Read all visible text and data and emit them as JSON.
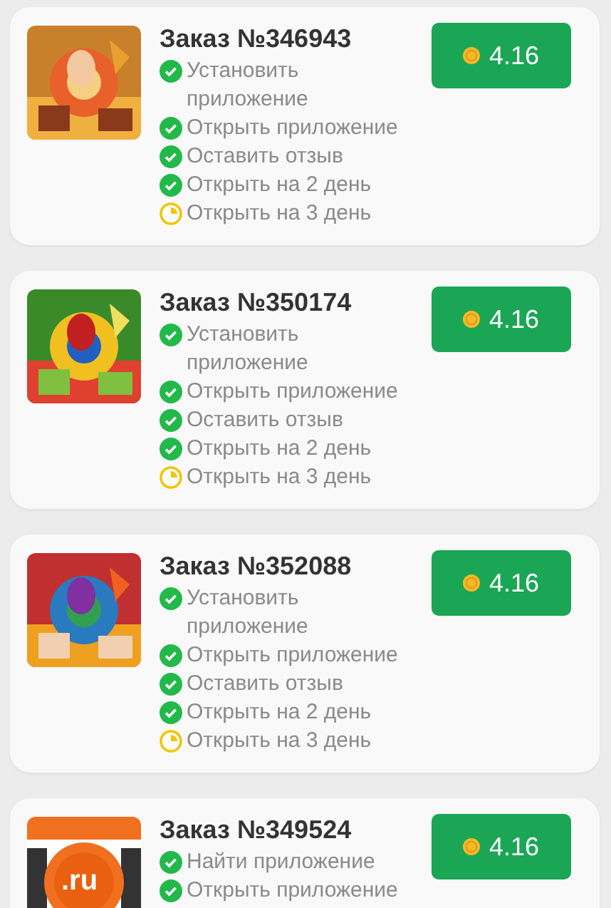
{
  "orders": [
    {
      "title": "Заказ №346943",
      "reward": "4.16",
      "steps": [
        {
          "label": "Установить приложение",
          "done": true
        },
        {
          "label": "Открыть приложение",
          "done": true
        },
        {
          "label": "Оставить отзыв",
          "done": true
        },
        {
          "label": "Открыть на 2 день",
          "done": true
        },
        {
          "label": "Открыть на 3 день",
          "done": false
        }
      ]
    },
    {
      "title": "Заказ №350174",
      "reward": "4.16",
      "steps": [
        {
          "label": "Установить приложение",
          "done": true
        },
        {
          "label": "Открыть приложение",
          "done": true
        },
        {
          "label": "Оставить отзыв",
          "done": true
        },
        {
          "label": "Открыть на 2 день",
          "done": true
        },
        {
          "label": "Открыть на 3 день",
          "done": false
        }
      ]
    },
    {
      "title": "Заказ №352088",
      "reward": "4.16",
      "steps": [
        {
          "label": "Установить приложение",
          "done": true
        },
        {
          "label": "Открыть приложение",
          "done": true
        },
        {
          "label": "Оставить отзыв",
          "done": true
        },
        {
          "label": "Открыть на 2 день",
          "done": true
        },
        {
          "label": "Открыть на 3 день",
          "done": false
        }
      ]
    },
    {
      "title": "Заказ №349524",
      "reward": "4.16",
      "app_icon": {
        "kind": "logo",
        "text": ".ru"
      },
      "steps": [
        {
          "label": "Найти приложение",
          "done": true
        },
        {
          "label": "Открыть приложение",
          "done": true
        }
      ]
    }
  ]
}
